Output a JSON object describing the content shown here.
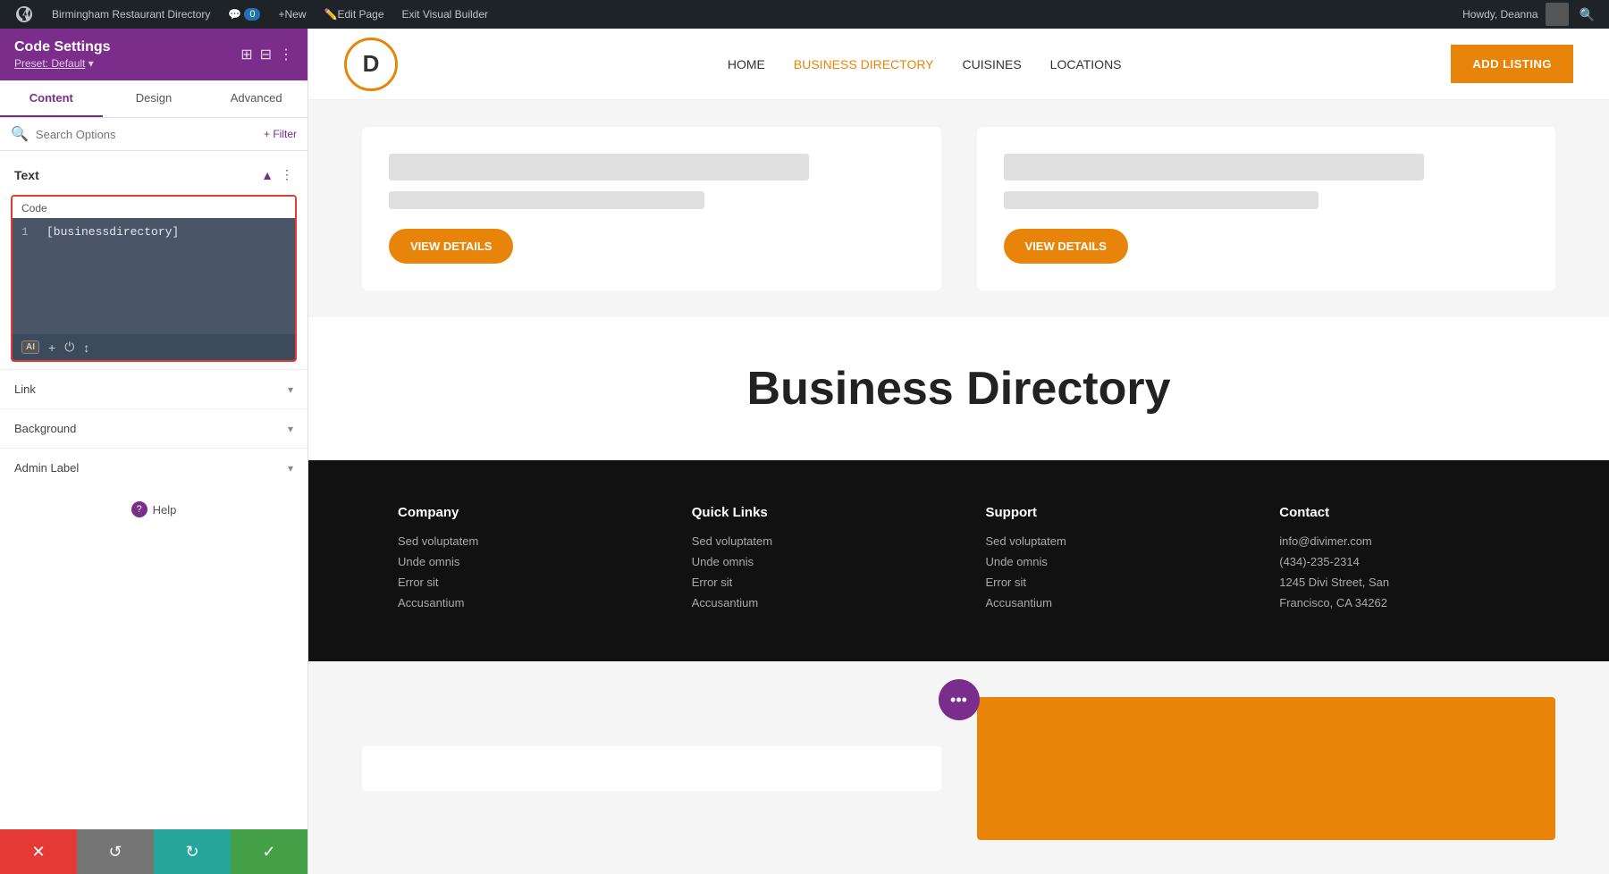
{
  "admin_bar": {
    "site_name": "Birmingham Restaurant Directory",
    "comment_count": "0",
    "new_label": "New",
    "edit_page_label": "Edit Page",
    "exit_builder_label": "Exit Visual Builder",
    "howdy": "Howdy, Deanna"
  },
  "sidebar": {
    "title": "Code Settings",
    "preset": "Preset: Default",
    "tabs": [
      "Content",
      "Design",
      "Advanced"
    ],
    "active_tab": "Content",
    "search_placeholder": "Search Options",
    "filter_label": "+ Filter",
    "sections": {
      "text": {
        "label": "Text",
        "code_label": "Code",
        "code_content": "[businessdirectory]",
        "line_number": "1"
      },
      "link": {
        "label": "Link"
      },
      "background": {
        "label": "Background"
      },
      "admin_label": {
        "label": "Admin Label"
      }
    },
    "help_label": "Help",
    "footer": {
      "cancel": "✕",
      "undo": "↺",
      "redo": "↻",
      "save": "✓"
    }
  },
  "site": {
    "logo_letter": "D",
    "nav_links": [
      "HOME",
      "BUSINESS DIRECTORY",
      "CUISINES",
      "LOCATIONS"
    ],
    "active_nav": "BUSINESS DIRECTORY",
    "add_listing_label": "ADD LISTING",
    "cards": [
      {
        "view_details": "VIEW DETAILS"
      },
      {
        "view_details": "VIEW DETAILS"
      }
    ],
    "business_dir_title": "Business Directory",
    "footer": {
      "columns": [
        {
          "title": "Company",
          "links": [
            "Sed voluptatem",
            "Unde omnis",
            "Error sit",
            "Accusantium"
          ]
        },
        {
          "title": "Quick Links",
          "links": [
            "Sed voluptatem",
            "Unde omnis",
            "Error sit",
            "Accusantium"
          ]
        },
        {
          "title": "Support",
          "links": [
            "Sed voluptatem",
            "Unde omnis",
            "Error sit",
            "Accusantium"
          ]
        },
        {
          "title": "Contact",
          "links": [
            "info@divimer.com",
            "(434)-235-2314",
            "1245 Divi Street, San",
            "Francisco, CA 34262"
          ]
        }
      ]
    },
    "dots_label": "•••"
  },
  "colors": {
    "purple": "#7b2d8b",
    "orange": "#e8840a",
    "red": "#e53935",
    "green": "#43a047",
    "teal": "#26a69a",
    "gray": "#757575"
  }
}
